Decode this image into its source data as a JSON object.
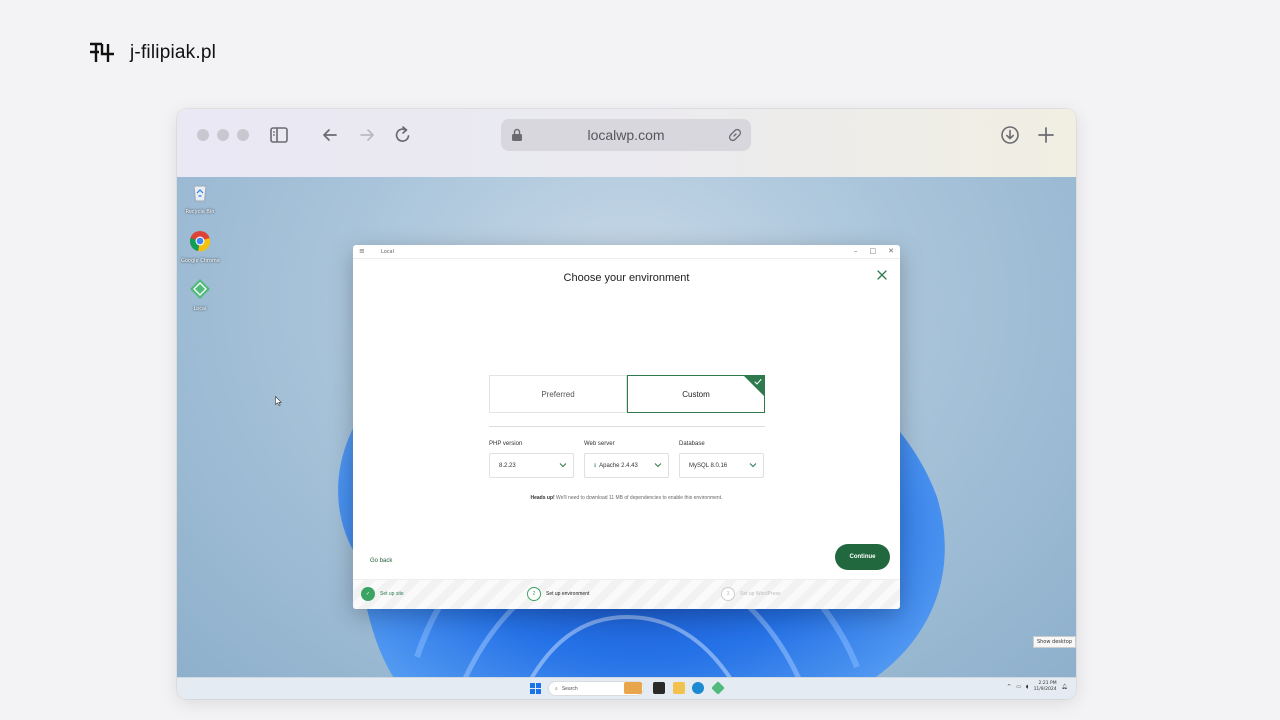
{
  "brand": {
    "name": "j-filipiak.pl"
  },
  "browser": {
    "url": "localwp.com"
  },
  "desktop": {
    "icons": [
      {
        "label": "Recycle Bin"
      },
      {
        "label": "Google Chrome"
      },
      {
        "label": "Local"
      }
    ]
  },
  "app": {
    "window_title": "Local",
    "dialog_title": "Choose your environment",
    "options": {
      "preferred": "Preferred",
      "custom": "Custom",
      "selected": "custom"
    },
    "fields": {
      "php": {
        "label": "PHP version",
        "value": "8.2.23"
      },
      "web": {
        "label": "Web server",
        "value": "Apache 2.4.43"
      },
      "db": {
        "label": "Database",
        "value": "MySQL 8.0.16"
      }
    },
    "notice": {
      "bold": "Heads up!",
      "text": " We'll need to download 11 MB of dependencies to enable this environment."
    },
    "go_back": "Go back",
    "continue": "Continue",
    "steps": [
      {
        "label": "Set up site",
        "num": "✓"
      },
      {
        "label": "Set up environment",
        "num": "2"
      },
      {
        "label": "Set up WordPress",
        "num": "3"
      }
    ]
  },
  "taskbar": {
    "search_placeholder": "Search",
    "time": "2:21 PM",
    "date": "11/9/2024",
    "show_desktop": "Show desktop"
  },
  "colors": {
    "accent_green": "#22683f",
    "step_green": "#3ba462"
  }
}
